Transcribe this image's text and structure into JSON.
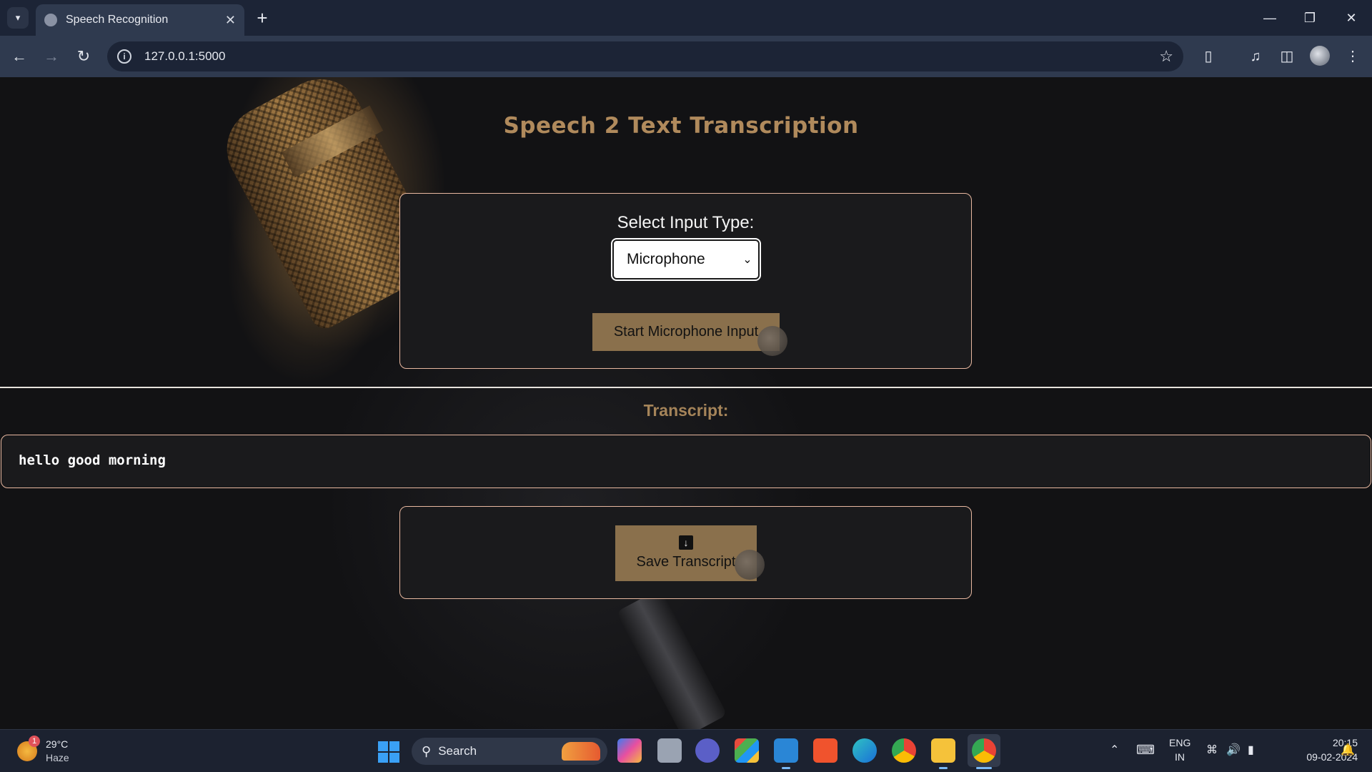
{
  "browser": {
    "tab_title": "Speech Recognition",
    "url": "127.0.0.1:5000"
  },
  "page": {
    "title": "Speech 2 Text Transcription",
    "select_label": "Select Input Type:",
    "select_value": "Microphone",
    "start_button": "Start Microphone Input",
    "transcript_label": "Transcript:",
    "transcript_text": "hello good morning",
    "save_button": "Save Transcript"
  },
  "taskbar": {
    "weather_temp": "29°C",
    "weather_desc": "Haze",
    "weather_badge": "1",
    "search_label": "Search",
    "lang_primary": "ENG",
    "lang_secondary": "IN",
    "time": "20:15",
    "date": "09-02-2024"
  },
  "colors": {
    "accent_gold": "#8a704c",
    "title_gold": "#b08a5c",
    "panel_border": "#e8b8a0",
    "chrome_bg": "#1c2436"
  }
}
